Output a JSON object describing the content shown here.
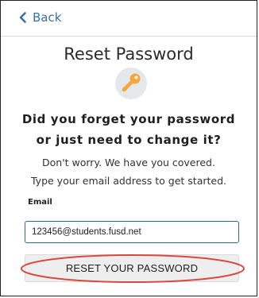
{
  "nav": {
    "back_label": "Back"
  },
  "page": {
    "title": "Reset Password",
    "headline_line1": "Did you forget your password",
    "headline_line2": "or just need to change it?",
    "description_line1": "Don't worry. We have you covered.",
    "description_line2": "Type your email address to get started."
  },
  "form": {
    "email_label": "Email",
    "email_value": "123456@students.fusd.net",
    "submit_label": "RESET YOUR PASSWORD"
  },
  "icons": {
    "back": "chevron-left-icon",
    "key": "key-icon"
  },
  "colors": {
    "link": "#3a6ea5",
    "key": "#f2a93b",
    "input_border": "#2f6d6a",
    "annotation": "#d64b3f"
  }
}
